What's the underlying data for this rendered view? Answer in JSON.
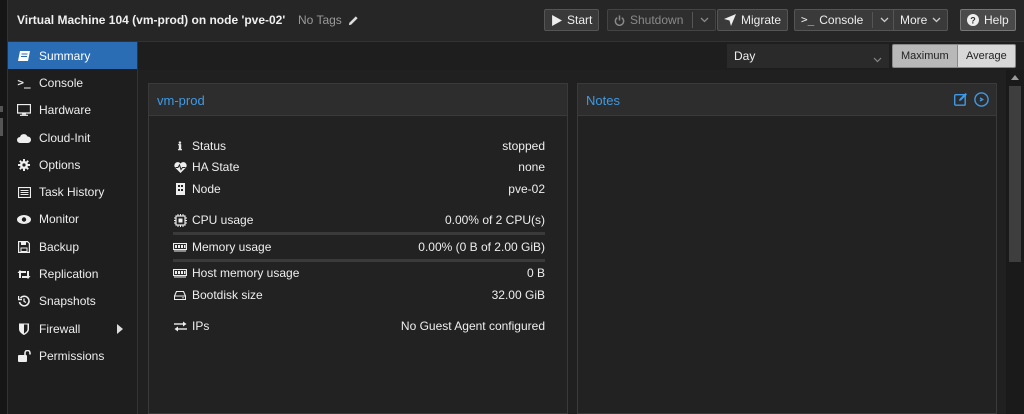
{
  "header": {
    "title": "Virtual Machine 104 (vm-prod) on node 'pve-02'",
    "tags": "No Tags",
    "buttons": {
      "start": "Start",
      "shutdown": "Shutdown",
      "migrate": "Migrate",
      "console": "Console",
      "more": "More",
      "help": "Help"
    }
  },
  "sidebar": {
    "items": [
      {
        "label": "Summary",
        "icon": "book-icon"
      },
      {
        "label": "Console",
        "icon": "terminal-icon"
      },
      {
        "label": "Hardware",
        "icon": "monitor-icon"
      },
      {
        "label": "Cloud-Init",
        "icon": "cloud-icon"
      },
      {
        "label": "Options",
        "icon": "gear-icon"
      },
      {
        "label": "Task History",
        "icon": "list-icon"
      },
      {
        "label": "Monitor",
        "icon": "eye-icon"
      },
      {
        "label": "Backup",
        "icon": "floppy-icon"
      },
      {
        "label": "Replication",
        "icon": "retweet-icon"
      },
      {
        "label": "Snapshots",
        "icon": "history-icon"
      },
      {
        "label": "Firewall",
        "icon": "shield-icon"
      },
      {
        "label": "Permissions",
        "icon": "unlock-icon"
      }
    ]
  },
  "toolbar": {
    "timeframe": "Day",
    "maximum": "Maximum",
    "average": "Average"
  },
  "summary": {
    "title": "vm-prod",
    "status_label": "Status",
    "status_value": "stopped",
    "ha_label": "HA State",
    "ha_value": "none",
    "node_label": "Node",
    "node_value": "pve-02",
    "cpu_label": "CPU usage",
    "cpu_value": "0.00% of 2 CPU(s)",
    "mem_label": "Memory usage",
    "mem_value": "0.00% (0 B of 2.00 GiB)",
    "hostmem_label": "Host memory usage",
    "hostmem_value": "0 B",
    "bootdisk_label": "Bootdisk size",
    "bootdisk_value": "32.00 GiB",
    "ips_label": "IPs",
    "ips_value": "No Guest Agent configured"
  },
  "notes": {
    "title": "Notes"
  },
  "colors": {
    "accent": "#3e9ae6",
    "active_nav": "#2a6db5"
  }
}
